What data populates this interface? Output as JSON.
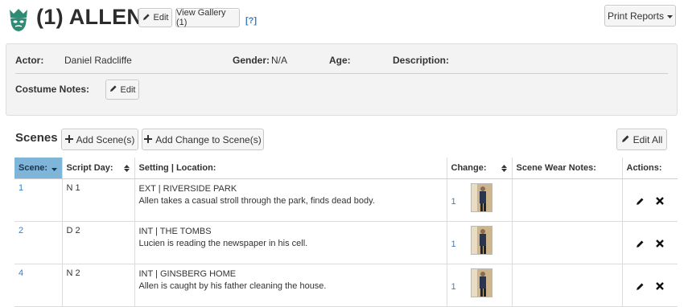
{
  "header": {
    "title": "(1) ALLEN",
    "edit_label": "Edit",
    "gallery_label": "View Gallery (1)",
    "help_label": "[?]",
    "print_reports_label": "Print Reports"
  },
  "info": {
    "actor_label": "Actor:",
    "actor_value": "Daniel Radcliffe",
    "gender_label": "Gender:",
    "gender_value": "N/A",
    "age_label": "Age:",
    "description_label": "Description:",
    "costume_notes_label": "Costume Notes:",
    "costume_edit_label": "Edit"
  },
  "scenes": {
    "title": "Scenes",
    "add_scene_label": "Add Scene(s)",
    "add_change_label": "Add Change to Scene(s)",
    "edit_all_label": "Edit All",
    "columns": {
      "scene": "Scene:",
      "script_day": "Script Day:",
      "setting": "Setting | Location:",
      "change": "Change:",
      "wear_notes": "Scene Wear Notes:",
      "actions": "Actions:"
    },
    "rows": [
      {
        "scene": "1",
        "script_day": "N 1",
        "setting": "EXT | RIVERSIDE PARK",
        "description": "Allen takes a casual stroll through the park, finds dead body.",
        "change": "1",
        "wear_notes": ""
      },
      {
        "scene": "2",
        "script_day": "D 2",
        "setting": "INT | THE TOMBS",
        "description": "Lucien is reading the newspaper in his cell.",
        "change": "1",
        "wear_notes": ""
      },
      {
        "scene": "4",
        "script_day": "N 2",
        "setting": "INT | GINSBERG HOME",
        "description": "Allen is caught by his father cleaning the house.",
        "change": "1",
        "wear_notes": ""
      }
    ]
  },
  "colors": {
    "brand": "#2e8b74",
    "link": "#3a7fc1",
    "sorted_header": "#7fb5d9"
  },
  "icons": {
    "logo": "mask-crown-logo-icon",
    "edit": "pencil-icon",
    "add": "plus-icon",
    "delete": "close-icon",
    "dropdown": "caret-down-icon",
    "sort": "sort-icon"
  }
}
